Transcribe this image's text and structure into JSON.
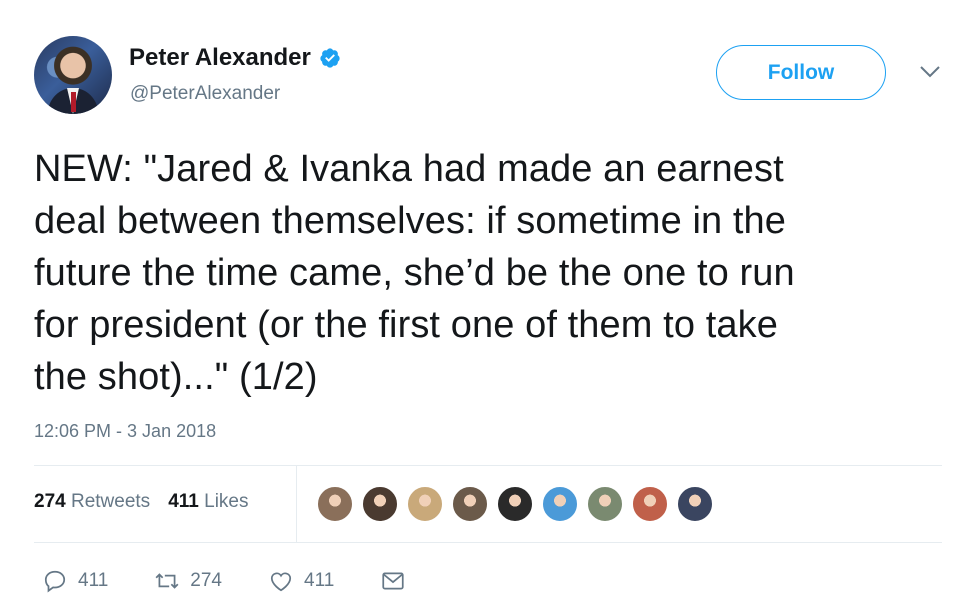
{
  "user": {
    "name": "Peter Alexander",
    "handle": "@PeterAlexander",
    "verified_color": "#1da1f2"
  },
  "follow_label": "Follow",
  "tweet": {
    "text": "NEW: \"Jared & Ivanka had made an earnest\ndeal between themselves: if sometime in the\nfuture the time came, she’d be the one to run\nfor president (or the first one of them to take\nthe shot)...\" (1/2)",
    "timestamp": "12:06 PM - 3 Jan 2018"
  },
  "stats": {
    "retweets_count": "274",
    "retweets_label": "Retweets",
    "likes_count": "411",
    "likes_label": "Likes"
  },
  "likers": [
    {
      "name": "liker-avatar",
      "color": "#8a6f5a"
    },
    {
      "name": "liker-avatar",
      "color": "#4a3a30"
    },
    {
      "name": "liker-avatar",
      "color": "#c9a97a"
    },
    {
      "name": "liker-avatar",
      "color": "#6b5a4a"
    },
    {
      "name": "liker-avatar",
      "color": "#2a2a2a"
    },
    {
      "name": "liker-avatar",
      "color": "#4b9ad8"
    },
    {
      "name": "liker-avatar",
      "color": "#7a8a70"
    },
    {
      "name": "liker-avatar",
      "color": "#c0604a"
    },
    {
      "name": "liker-avatar",
      "color": "#3a4560"
    }
  ],
  "actions": {
    "reply_count": "411",
    "retweet_count": "274",
    "like_count": "411"
  },
  "colors": {
    "accent": "#1da1f2",
    "secondary_text": "#657786"
  }
}
